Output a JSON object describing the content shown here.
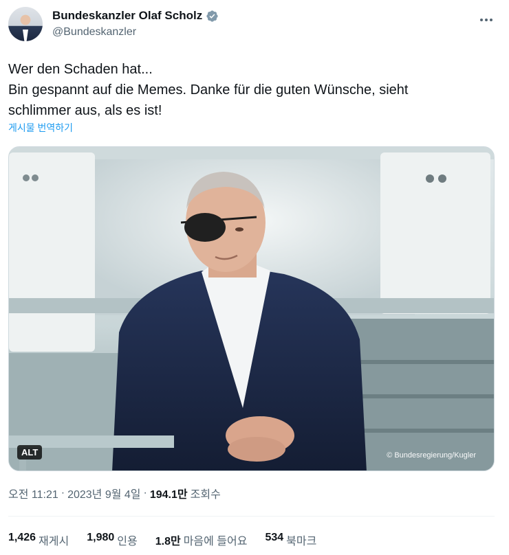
{
  "author": {
    "display_name": "Bundeskanzler Olaf Scholz",
    "handle": "@Bundeskanzler",
    "verified_icon": "verified-badge-icon",
    "verified_color": "#829aab"
  },
  "tweet": {
    "lines": [
      "Wer den Schaden hat...",
      "Bin gespannt auf die Memes. Danke für die guten Wünsche, sieht",
      "schlimmer aus, als es ist!"
    ],
    "translate_label": "게시물 번역하기"
  },
  "media": {
    "alt_label": "ALT",
    "credit": "© Bundesregierung/Kugler"
  },
  "meta": {
    "time": "오전 11:21",
    "separator": "·",
    "date": "2023년 9월 4일",
    "views_count": "194.1만",
    "views_label": "조회수"
  },
  "stats": [
    {
      "num": "1,426",
      "label": "재게시"
    },
    {
      "num": "1,980",
      "label": "인용"
    },
    {
      "num": "1.8만",
      "label": "마음에 들어요"
    },
    {
      "num": "534",
      "label": "북마크"
    }
  ],
  "colors": {
    "link": "#1d9bf0",
    "secondary_text": "#536471",
    "primary_text": "#0f1419"
  }
}
